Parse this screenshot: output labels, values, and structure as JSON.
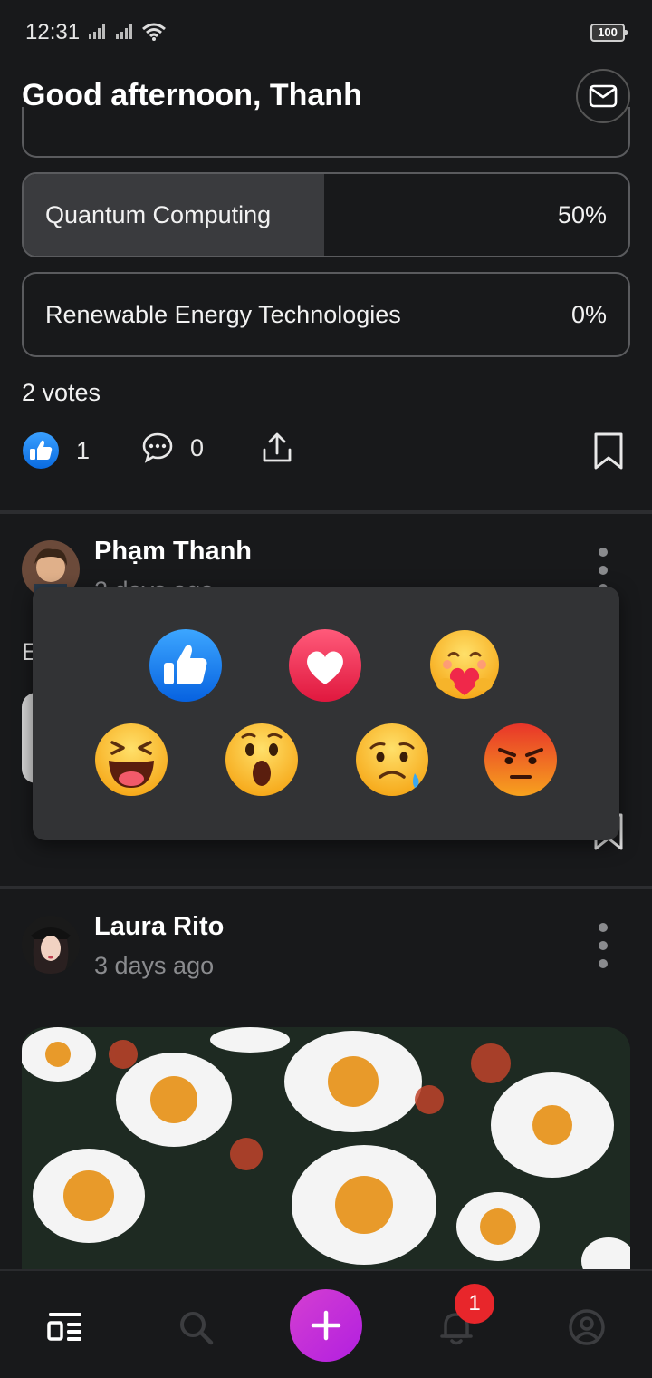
{
  "status_bar": {
    "time": "12:31",
    "battery": "100"
  },
  "header": {
    "greeting": "Good afternoon, Thanh",
    "mail_icon": "mail-icon"
  },
  "poll": {
    "options": [
      {
        "label": "Quantum Computing",
        "percent_text": "50%",
        "percent": 50
      },
      {
        "label": "Renewable Energy Technologies",
        "percent_text": "0%",
        "percent": 0
      }
    ],
    "votes": "2 votes"
  },
  "poll_actions": {
    "like_count": "1",
    "comment_count": "0"
  },
  "post1": {
    "author": "Phạm Thanh",
    "time": "2 days ago",
    "text_start": "E"
  },
  "reactions": [
    "like",
    "love",
    "care",
    "haha",
    "wow",
    "sad",
    "angry"
  ],
  "post2": {
    "author": "Laura Rito",
    "time": "3 days ago"
  },
  "nav": {
    "notification_badge": "1",
    "accent": "#c52ee0"
  }
}
